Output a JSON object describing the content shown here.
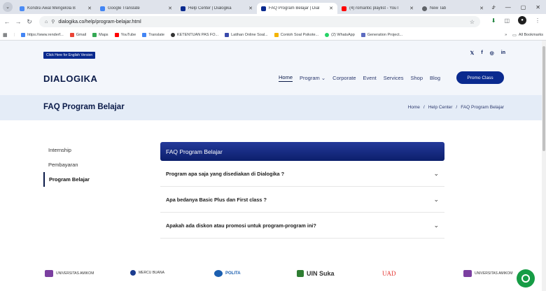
{
  "browser": {
    "tabs": [
      {
        "title": "Kondisi Awal Mengelola B",
        "color": "#4b8bf5",
        "active": false
      },
      {
        "title": "Google Translate",
        "color": "#4285f4",
        "active": false
      },
      {
        "title": "Help Center | Dialogika",
        "color": "#0a2a8f",
        "active": false
      },
      {
        "title": "FAQ Program Belajar | Dial",
        "color": "#0a2a8f",
        "active": true
      },
      {
        "title": "(4) romantic playlist - YouT",
        "color": "#ff0000",
        "active": false
      },
      {
        "title": "New Tab",
        "color": "#5f6368",
        "active": false
      }
    ],
    "new_tab_symbol": "+",
    "window_controls": [
      "⌄",
      "—",
      "▢",
      "✕"
    ],
    "url": "dialogika.co/help/program-belajar.html",
    "bookmarks": [
      {
        "label": "https://www.renderf...",
        "color": "#4285f4"
      },
      {
        "label": "Gmail",
        "color": "#ea4335"
      },
      {
        "label": "Maps",
        "color": "#34a853"
      },
      {
        "label": "YouTube",
        "color": "#ff0000"
      },
      {
        "label": "Translate",
        "color": "#4285f4"
      },
      {
        "label": "KETENTUAN PAS FO...",
        "color": "#333333"
      },
      {
        "label": "Latihan Online Soal...",
        "color": "#3949ab"
      },
      {
        "label": "Contoh Soal Psikote...",
        "color": "#f4b400"
      },
      {
        "label": "(2) WhatsApp",
        "color": "#25d366"
      },
      {
        "label": "Generation Project...",
        "color": "#5c6bc0"
      }
    ],
    "all_bookmarks": "All Bookmarks"
  },
  "page": {
    "english_button": "Click Here for English Version",
    "social": [
      "𝕏",
      "f",
      "◎",
      "in"
    ],
    "logo": "DIALOGIKA",
    "nav": {
      "home": "Home",
      "program": "Program ⌄",
      "corporate": "Corporate",
      "event": "Event",
      "services": "Services",
      "shop": "Shop",
      "blog": "Blog"
    },
    "promo_button": "Promo Class",
    "title": "FAQ Program Belajar",
    "breadcrumb": [
      "Home",
      "/",
      "Help Center",
      "/",
      "FAQ Program Belajar"
    ],
    "sidebar": [
      "Internship",
      "Pembayaran",
      "Program Belajar"
    ],
    "faq": {
      "heading": "FAQ Program Belajar",
      "items": [
        "Program apa saja yang disediakan di Dialogika ?",
        "Apa bedanya Basic Plus dan First class ?",
        "Apakah ada diskon atau promosi untuk program-program ini?"
      ]
    },
    "partner_logos": [
      {
        "label": "UNIVERSITAS AMIKOM",
        "color": "#7b3fa0"
      },
      {
        "label": "MERCU BUANA",
        "color": "#1b3c8f"
      },
      {
        "label": "POLITA",
        "color": "#1b5fb0"
      },
      {
        "label": "UIN Suka",
        "color": "#2e7d32"
      },
      {
        "label": "UAD",
        "color": "#e53935"
      },
      {
        "label": "UNIVERSITAS AMIKOM",
        "color": "#7b3fa0"
      }
    ]
  }
}
